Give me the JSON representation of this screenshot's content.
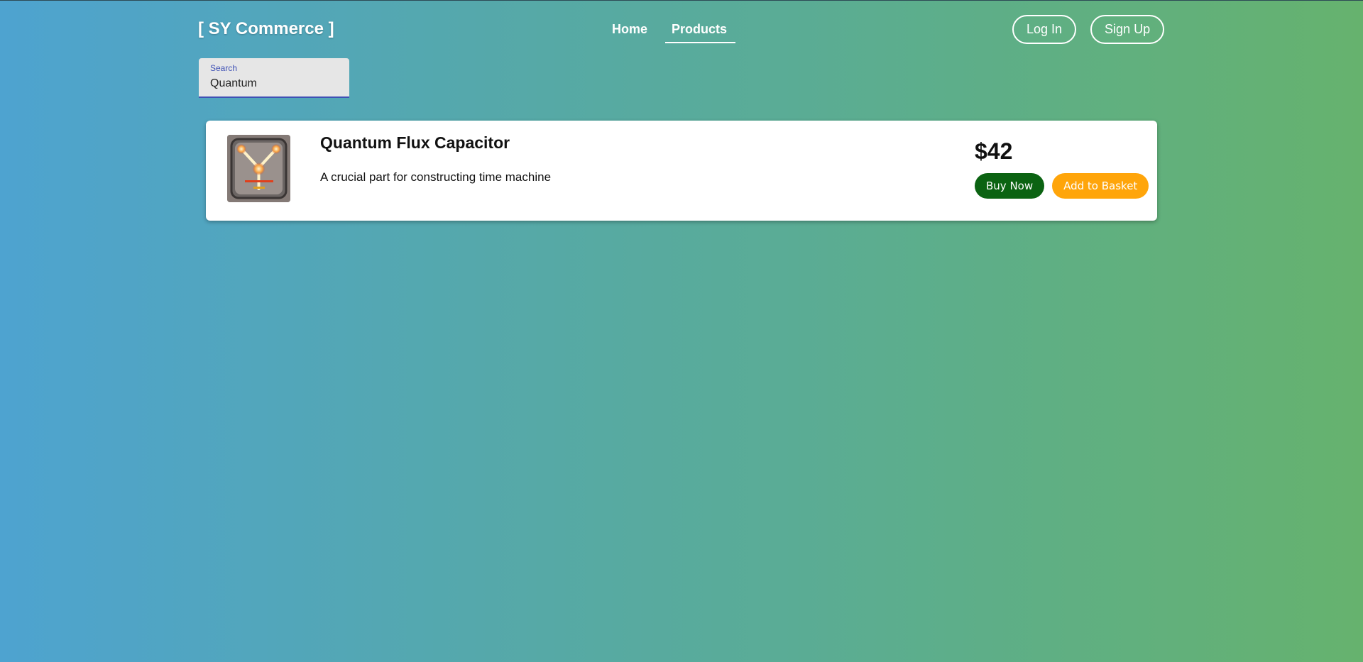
{
  "header": {
    "brand": "[ SY Commerce ]",
    "nav": [
      {
        "label": "Home",
        "active": false
      },
      {
        "label": "Products",
        "active": true
      }
    ],
    "login_label": "Log In",
    "signup_label": "Sign Up"
  },
  "search": {
    "label": "Search",
    "value": "Quantum"
  },
  "products": [
    {
      "name": "Quantum Flux Capacitor",
      "description": "A crucial part for constructing time machine",
      "price": "$42",
      "buy_label": "Buy Now",
      "basket_label": "Add to Basket",
      "image_icon": "flux-capacitor-image"
    }
  ],
  "colors": {
    "gradient_start": "#4ea3d0",
    "gradient_end": "#66b26e",
    "buy_button": "#0b6312",
    "basket_button": "#ffa50a",
    "search_accent": "#3f51b5"
  }
}
